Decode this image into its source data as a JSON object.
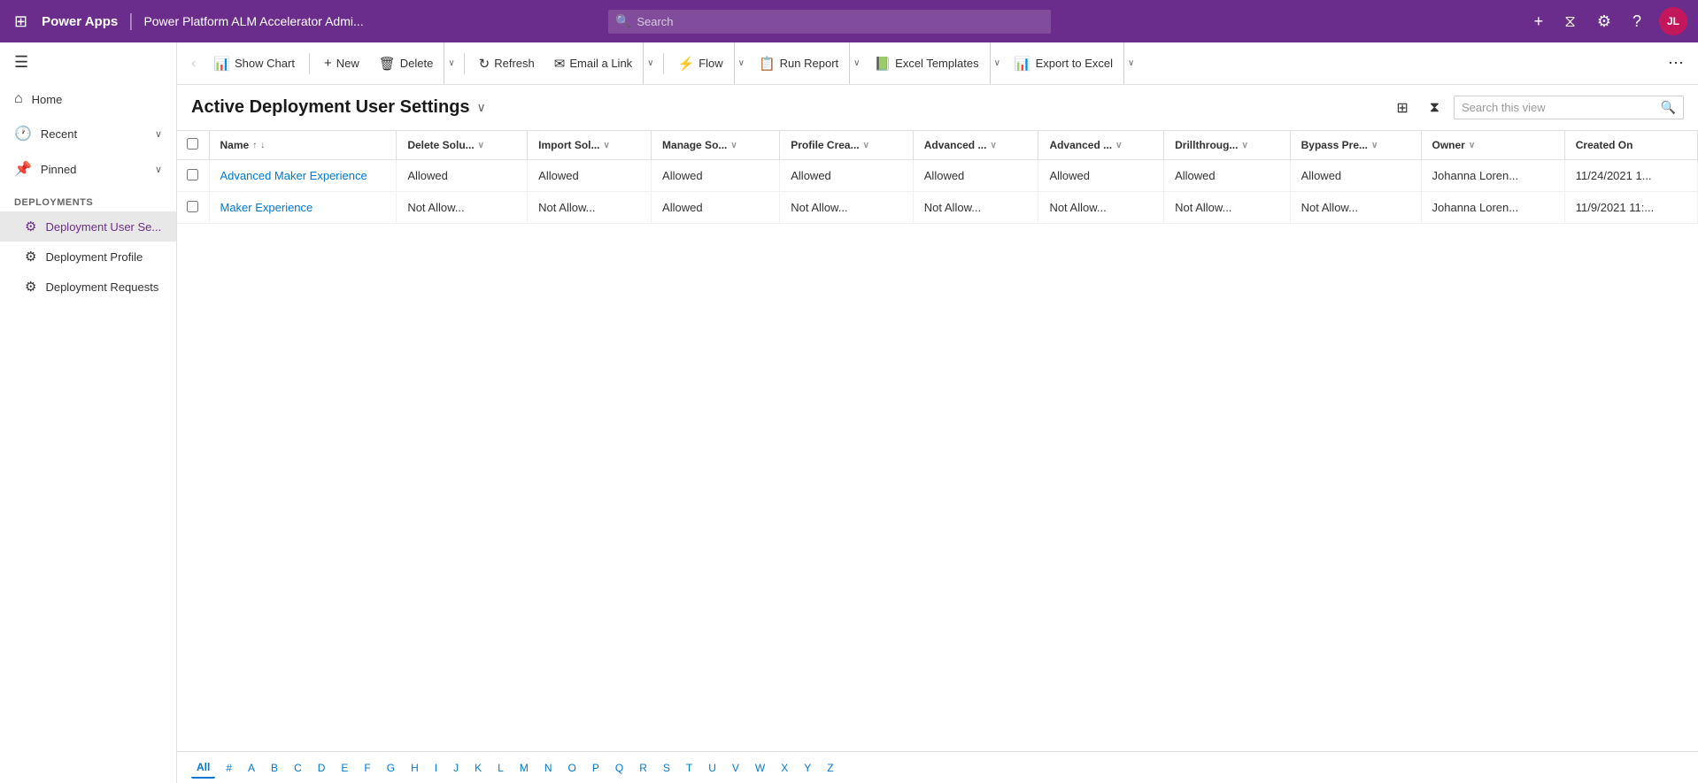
{
  "topNav": {
    "appName": "Power Apps",
    "breadcrumb": "Power Platform ALM Accelerator Admi...",
    "searchPlaceholder": "Search",
    "addIcon": "+",
    "filterIcon": "⧖",
    "settingsIcon": "⚙",
    "helpIcon": "?",
    "avatarText": "JL"
  },
  "toolbar": {
    "backLabel": "‹",
    "showChartLabel": "Show Chart",
    "newLabel": "New",
    "deleteLabel": "Delete",
    "refreshLabel": "Refresh",
    "emailLinkLabel": "Email a Link",
    "flowLabel": "Flow",
    "runReportLabel": "Run Report",
    "excelTemplatesLabel": "Excel Templates",
    "exportToExcelLabel": "Export to Excel"
  },
  "viewHeader": {
    "title": "Active Deployment User Settings",
    "searchPlaceholder": "Search this view"
  },
  "grid": {
    "columns": [
      {
        "id": "name",
        "label": "Name",
        "sortable": true,
        "filterable": true
      },
      {
        "id": "deleteSolu",
        "label": "Delete Solu...",
        "sortable": false,
        "filterable": true
      },
      {
        "id": "importSol",
        "label": "Import Sol...",
        "sortable": false,
        "filterable": true
      },
      {
        "id": "manageSo",
        "label": "Manage So...",
        "sortable": false,
        "filterable": true
      },
      {
        "id": "profileCrea",
        "label": "Profile Crea...",
        "sortable": false,
        "filterable": true
      },
      {
        "id": "advanced1",
        "label": "Advanced ...",
        "sortable": false,
        "filterable": true
      },
      {
        "id": "advanced2",
        "label": "Advanced ...",
        "sortable": false,
        "filterable": true
      },
      {
        "id": "drillthrough",
        "label": "Drillthroug...",
        "sortable": false,
        "filterable": true
      },
      {
        "id": "bypassPre",
        "label": "Bypass Pre...",
        "sortable": false,
        "filterable": true
      },
      {
        "id": "owner",
        "label": "Owner",
        "sortable": false,
        "filterable": true
      },
      {
        "id": "createdOn",
        "label": "Created On",
        "sortable": false,
        "filterable": false
      }
    ],
    "rows": [
      {
        "name": "Advanced Maker Experience",
        "deleteSolu": "Allowed",
        "importSol": "Allowed",
        "manageSo": "Allowed",
        "profileCrea": "Allowed",
        "advanced1": "Allowed",
        "advanced2": "Allowed",
        "drillthrough": "Allowed",
        "bypassPre": "Allowed",
        "owner": "Johanna Loren...",
        "createdOn": "11/24/2021 1..."
      },
      {
        "name": "Maker Experience",
        "deleteSolu": "Not Allow...",
        "importSol": "Not Allow...",
        "manageSo": "Allowed",
        "profileCrea": "Not Allow...",
        "advanced1": "Not Allow...",
        "advanced2": "Not Allow...",
        "drillthrough": "Not Allow...",
        "bypassPre": "Not Allow...",
        "owner": "Johanna Loren...",
        "createdOn": "11/9/2021 11:..."
      }
    ]
  },
  "sidebar": {
    "homeLabel": "Home",
    "recentLabel": "Recent",
    "pinnedLabel": "Pinned",
    "deploymentsHeader": "Deployments",
    "deploymentUserSeLabel": "Deployment User Se...",
    "deploymentProfileLabel": "Deployment Profile",
    "deploymentRequestsLabel": "Deployment Requests"
  },
  "pagination": {
    "letters": [
      "All",
      "#",
      "A",
      "B",
      "C",
      "D",
      "E",
      "F",
      "G",
      "H",
      "I",
      "J",
      "K",
      "L",
      "M",
      "N",
      "O",
      "P",
      "Q",
      "R",
      "S",
      "T",
      "U",
      "V",
      "W",
      "X",
      "Y",
      "Z"
    ]
  }
}
